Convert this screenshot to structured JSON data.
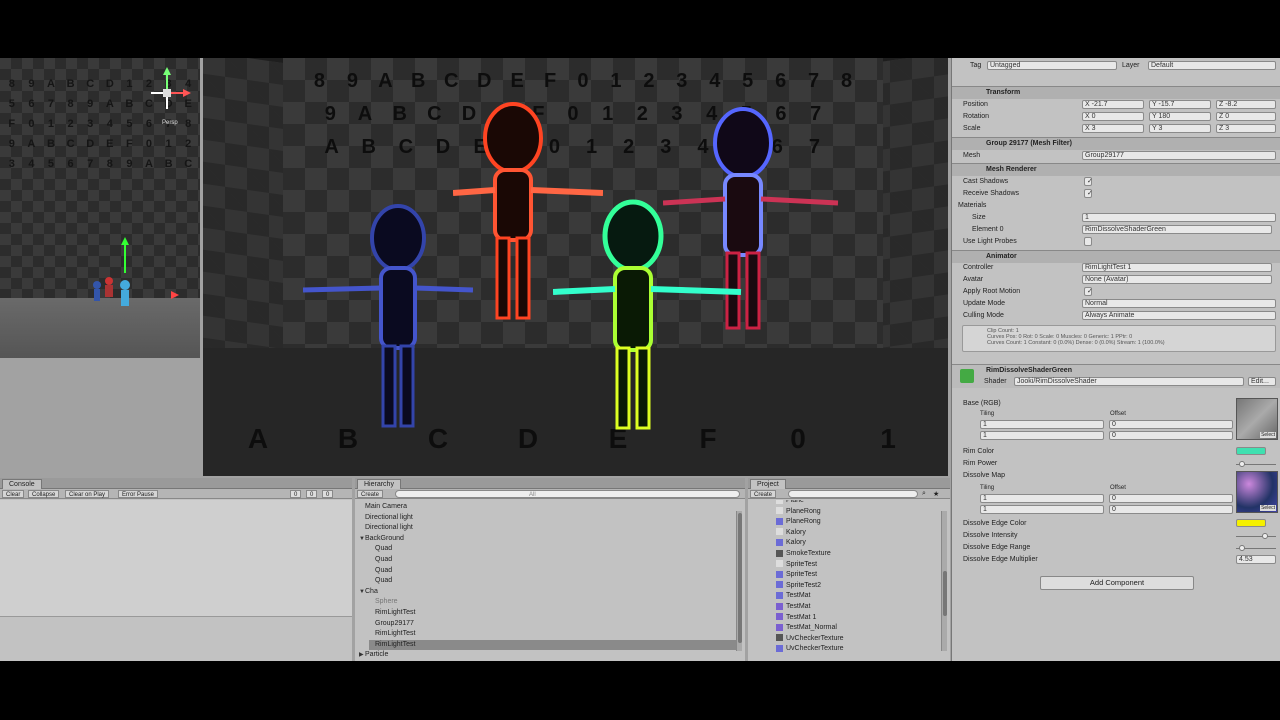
{
  "scene": {
    "gizmo_label": "Persp",
    "wall_chars": [
      "8",
      "9",
      "A",
      "B",
      "C",
      "D",
      "1",
      "2",
      "3",
      "4",
      "5",
      "6",
      "7",
      "8",
      "9",
      "A",
      "B",
      "C",
      "D",
      "E",
      "F",
      "0",
      "1",
      "2",
      "3",
      "4",
      "5",
      "6",
      "7",
      "8",
      "9",
      "A",
      "B",
      "C",
      "D",
      "E",
      "F",
      "0",
      "1",
      "2",
      "3",
      "4",
      "5",
      "6",
      "7",
      "8",
      "9",
      "A",
      "B",
      "C"
    ]
  },
  "game": {
    "back_row1": [
      "8",
      "9",
      "A",
      "B",
      "C",
      "D",
      "E",
      "F",
      "0",
      "1",
      "2",
      "3",
      "4",
      "5",
      "6",
      "7",
      "8"
    ],
    "back_row2": [
      "9",
      "A",
      "B",
      "C",
      "D",
      "E",
      "F",
      "0",
      "1",
      "2",
      "3",
      "4",
      "5",
      "6",
      "7"
    ],
    "back_row3": [
      "A",
      "B",
      "C",
      "D",
      "E",
      "F",
      "0",
      "1",
      "2",
      "3",
      "4",
      "5",
      "6",
      "7"
    ],
    "floor_row": [
      "A",
      "B",
      "C",
      "D",
      "E",
      "F",
      "0",
      "1"
    ]
  },
  "inspector": {
    "tag_label": "Tag",
    "tag_value": "Untagged",
    "layer_label": "Layer",
    "layer_value": "Default",
    "transform": {
      "title": "Transform",
      "position_label": "Position",
      "rotation_label": "Rotation",
      "scale_label": "Scale",
      "position": {
        "x": "X -21.7",
        "y": "Y -15.7",
        "z": "Z -8.2"
      },
      "rotation": {
        "x": "X 0",
        "y": "Y 180",
        "z": "Z 0"
      },
      "scale": {
        "x": "X 3",
        "y": "Y 3",
        "z": "Z 3"
      }
    },
    "mesh_filter": {
      "title": "Group 29177 (Mesh Filter)",
      "mesh_label": "Mesh",
      "mesh_value": "Group29177"
    },
    "mesh_renderer": {
      "title": "Mesh Renderer",
      "cast_shadows": "Cast Shadows",
      "receive_shadows": "Receive Shadows",
      "materials": "Materials",
      "size_label": "Size",
      "size_value": "1",
      "element_label": "Element 0",
      "element_value": "RimDissolveShaderGreen",
      "light_probes": "Use Light Probes"
    },
    "animator": {
      "title": "Animator",
      "controller_label": "Controller",
      "controller_value": "RimLightTest 1",
      "avatar_label": "Avatar",
      "avatar_value": "None (Avatar)",
      "root_motion_label": "Apply Root Motion",
      "update_mode_label": "Update Mode",
      "update_mode_value": "Normal",
      "culling_label": "Culling Mode",
      "culling_value": "Always Animate",
      "info_line1": "Clip Count: 1",
      "info_line2": "Curves Pos: 0 Rot: 0 Scale: 0 Muscles: 0 Generic: 1 PPtr: 0",
      "info_line3": "Curves Count: 1 Constant: 0 (0.0%) Dense: 0 (0.0%) Stream: 1 (100.0%)"
    },
    "material": {
      "title": "RimDissolveShaderGreen",
      "shader_label": "Shader",
      "shader_value": "Jooki/RimDissolveShader",
      "edit_label": "Edit...",
      "base_label": "Base (RGB)",
      "tiling_label": "Tiling",
      "offset_label": "Offset",
      "x1": "1",
      "y1": "1",
      "ox1": "0",
      "oy1": "0",
      "select1": "Select",
      "rim_color": "Rim Color",
      "rim_power": "Rim Power",
      "dissolve_map": "Dissolve Map",
      "tiling2": "Tiling",
      "offset2": "Offset",
      "x2": "1",
      "y2": "1",
      "ox2": "0",
      "oy2": "0",
      "select2": "Select",
      "edge_color": "Dissolve Edge Color",
      "intensity": "Dissolve Intensity",
      "edge_range": "Dissolve Edge Range",
      "edge_mult": "Dissolve Edge Multiplier",
      "edge_mult_value": "4.53",
      "rim_hex": "#3fe0b0",
      "edge_hex": "#f5f000"
    },
    "add_component": "Add Component"
  },
  "console": {
    "tab": "Console",
    "buttons": [
      "Clear",
      "Collapse",
      "Clear on Play",
      "Error Pause"
    ],
    "counts": [
      "0",
      "0",
      "0"
    ]
  },
  "hierarchy": {
    "tab": "Hierarchy",
    "create": "Create",
    "search": "All",
    "items": [
      {
        "label": "Main Camera",
        "indent": 0,
        "arrow": ""
      },
      {
        "label": "Directional light",
        "indent": 0,
        "arrow": ""
      },
      {
        "label": "Directional light",
        "indent": 0,
        "arrow": ""
      },
      {
        "label": "BackGround",
        "indent": 0,
        "arrow": "▼"
      },
      {
        "label": "Quad",
        "indent": 1,
        "arrow": ""
      },
      {
        "label": "Quad",
        "indent": 1,
        "arrow": ""
      },
      {
        "label": "Quad",
        "indent": 1,
        "arrow": ""
      },
      {
        "label": "Quad",
        "indent": 1,
        "arrow": ""
      },
      {
        "label": "Cha",
        "indent": 0,
        "arrow": "▼"
      },
      {
        "label": "Sphere",
        "indent": 1,
        "arrow": ""
      },
      {
        "label": "RimLightTest",
        "indent": 1,
        "arrow": ""
      },
      {
        "label": "Group29177",
        "indent": 1,
        "arrow": ""
      },
      {
        "label": "RimLightTest",
        "indent": 1,
        "arrow": ""
      },
      {
        "label": "RimLightTest",
        "indent": 1,
        "arrow": ""
      },
      {
        "label": "Particle",
        "indent": 0,
        "arrow": "▶"
      }
    ]
  },
  "project": {
    "tab": "Project",
    "create": "Create",
    "items": [
      {
        "label": "Plane",
        "color": "#ddd"
      },
      {
        "label": "PlaneRong",
        "color": "#ddd"
      },
      {
        "label": "PlaneRong",
        "color": "#6b6bd6"
      },
      {
        "label": "Kalory",
        "color": "#ddd"
      },
      {
        "label": "Kalory",
        "color": "#6b6bd6"
      },
      {
        "label": "SmokeTexture",
        "color": "#555"
      },
      {
        "label": "SpriteTest",
        "color": "#ddd"
      },
      {
        "label": "SpriteTest",
        "color": "#6b6bd6"
      },
      {
        "label": "SpriteTest2",
        "color": "#6b6bd6"
      },
      {
        "label": "TestMat",
        "color": "#6b6bd6"
      },
      {
        "label": "TestMat",
        "color": "#7a5fd0"
      },
      {
        "label": "TestMat 1",
        "color": "#7a5fd0"
      },
      {
        "label": "TestMat_Normal",
        "color": "#7a5fd0"
      },
      {
        "label": "UvCheckerTexture",
        "color": "#555"
      },
      {
        "label": "UvCheckerTexture",
        "color": "#6b6bd6"
      }
    ]
  }
}
